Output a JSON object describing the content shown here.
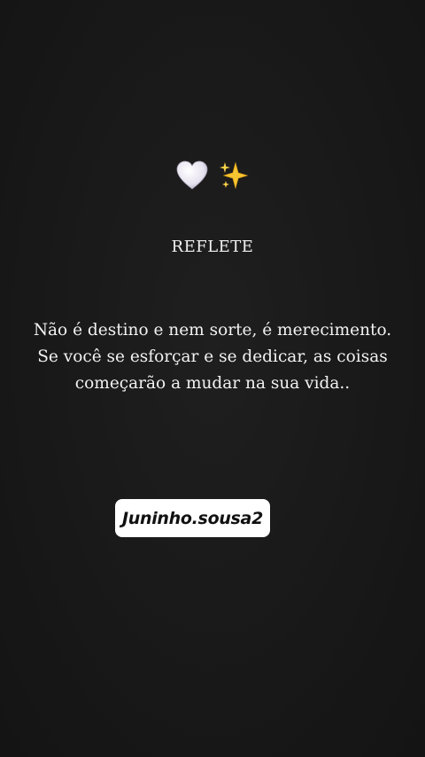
{
  "story": {
    "icons": [
      "white-heart-icon",
      "sparkles-icon"
    ],
    "heading": "REFLETE",
    "quote": "Não é destino e nem sorte, é merecimento. Se você se esforçar e se dedicar, as coisas começarão a mudar na sua vida..",
    "handle": "Juninho.sousa2"
  },
  "colors": {
    "background": "#191919",
    "text": "#f2f2f2",
    "handle_bg": "#ffffff",
    "handle_text": "#111111"
  }
}
